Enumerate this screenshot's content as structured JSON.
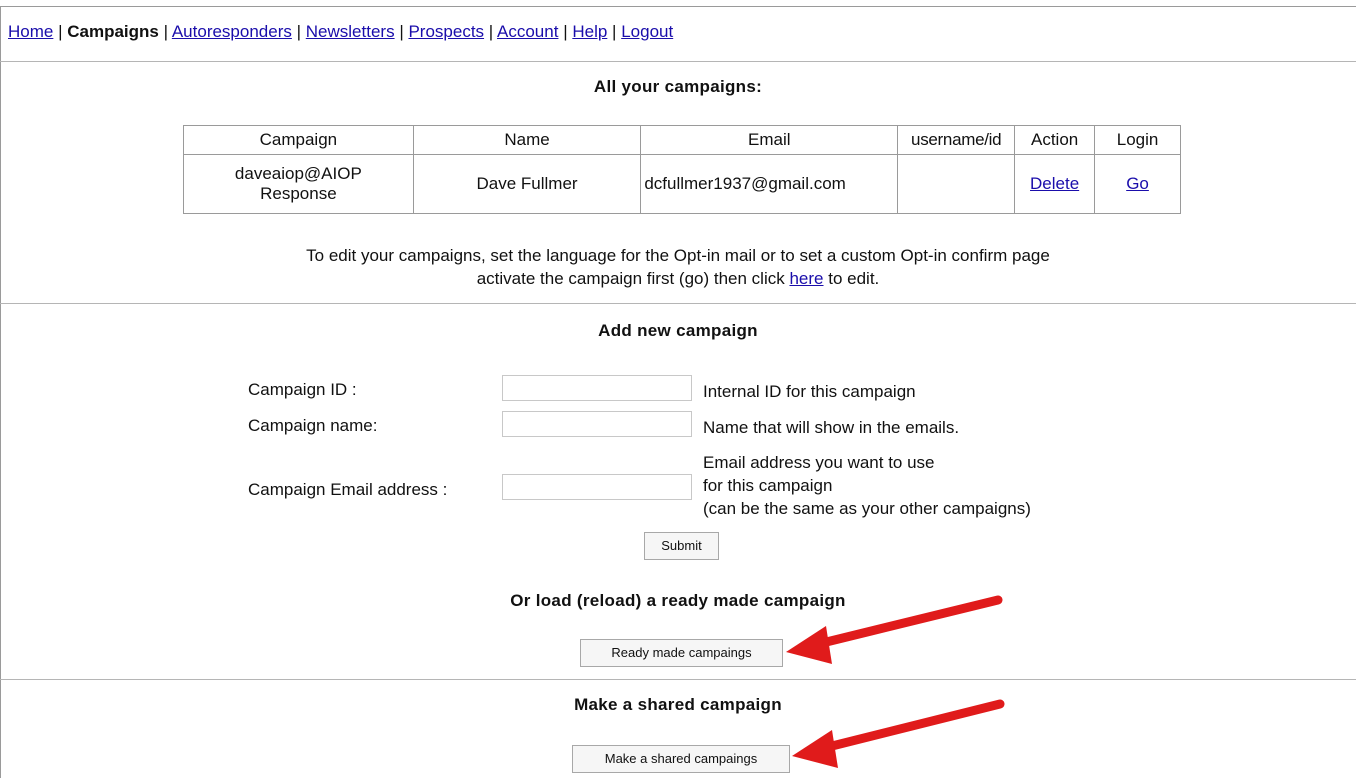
{
  "nav": {
    "home": "Home",
    "campaigns": "Campaigns",
    "autoresponders": "Autoresponders",
    "newsletters": "Newsletters",
    "prospects": "Prospects",
    "account": "Account",
    "help": "Help",
    "logout": "Logout",
    "separator": "|"
  },
  "campaigns_section": {
    "heading": "All your campaigns:",
    "columns": [
      "Campaign",
      "Name",
      "Email",
      "username/id",
      "Action",
      "Login"
    ],
    "rows": [
      {
        "campaign_line1": "daveaiop@AIOP",
        "campaign_line2": "Response",
        "name": "Dave Fullmer",
        "email": "dcfullmer1937@gmail.com",
        "username": "",
        "action": "Delete",
        "login": "Go"
      }
    ],
    "note_line1": "To edit your campaigns, set the language for the Opt-in mail or to set a custom Opt-in confirm page",
    "note_line2_pre": "activate the campaign first (go) then click",
    "note_link": "here",
    "note_line2_post": "to edit."
  },
  "add_campaign": {
    "heading": "Add new campaign",
    "campaign_id_label": "Campaign ID :",
    "campaign_id_value": "",
    "campaign_id_help": "Internal ID for this campaign",
    "campaign_name_label": "Campaign name:",
    "campaign_name_value": "",
    "campaign_name_help": "Name that will show in the emails.",
    "email_label": "Campaign Email address :",
    "email_value": "",
    "email_help_line1": "Email address you want to use",
    "email_help_line2": "for this campaign",
    "email_help_line3": "(can be the same as your other campaigns)",
    "submit_label": "Submit"
  },
  "ready_made": {
    "heading": "Or load (reload) a ready made campaign",
    "button_label": "Ready made campaings"
  },
  "shared": {
    "heading": "Make a shared campaign",
    "button_label": "Make a shared campaings"
  },
  "colors": {
    "link": "#1a0dab",
    "arrow": "#e01b1b"
  }
}
